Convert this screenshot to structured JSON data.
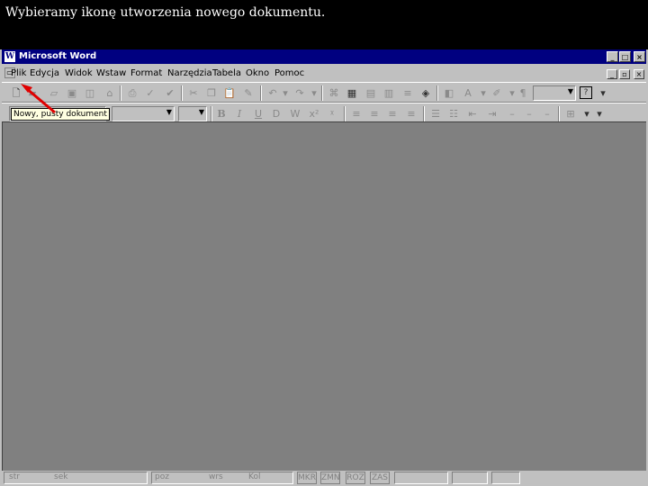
{
  "caption": "Wybieramy ikonę utworzenia nowego dokumentu.",
  "window": {
    "title": "Microsoft Word",
    "app_icon": "W",
    "controls": {
      "minimize": "_",
      "maximize": "□",
      "close": "×"
    }
  },
  "menu": {
    "items": [
      "Plik",
      "Edycja",
      "Widok",
      "Wstaw",
      "Format",
      "Narzędzia",
      "Tabela",
      "Okno",
      "Pomoc"
    ],
    "controls": {
      "minimize": "_",
      "restore": "▫",
      "close": "×"
    }
  },
  "standard_toolbar": {
    "icons": [
      "new-document-icon",
      "open-icon",
      "save-icon",
      "print-icon",
      "print-preview-icon",
      "spelling-icon",
      "cut-icon",
      "copy-icon",
      "paste-icon",
      "format-painter-icon",
      "undo-icon",
      "redo-icon",
      "hyperlink-icon",
      "tables-borders-icon",
      "insert-table-icon",
      "insert-excel-icon",
      "columns-icon",
      "drawing-icon",
      "document-map-icon",
      "show-hide-icon",
      "zoom-combo",
      "help-icon"
    ]
  },
  "tooltip": "Nowy, pusty dokument",
  "formatting_toolbar": {
    "bold": "B",
    "italic": "I",
    "underline": "U"
  },
  "statusbar": {
    "fields": [
      "str",
      "sek",
      "poz",
      "wrs",
      "Kol"
    ],
    "flags": [
      "MKR",
      "ZMN",
      "ROZ",
      "ZAS"
    ]
  },
  "colors": {
    "title_bar": "#000080",
    "chrome": "#c0c0c0",
    "workspace": "#808080",
    "tooltip_bg": "#ffffe1",
    "arrow": "#e00000"
  }
}
